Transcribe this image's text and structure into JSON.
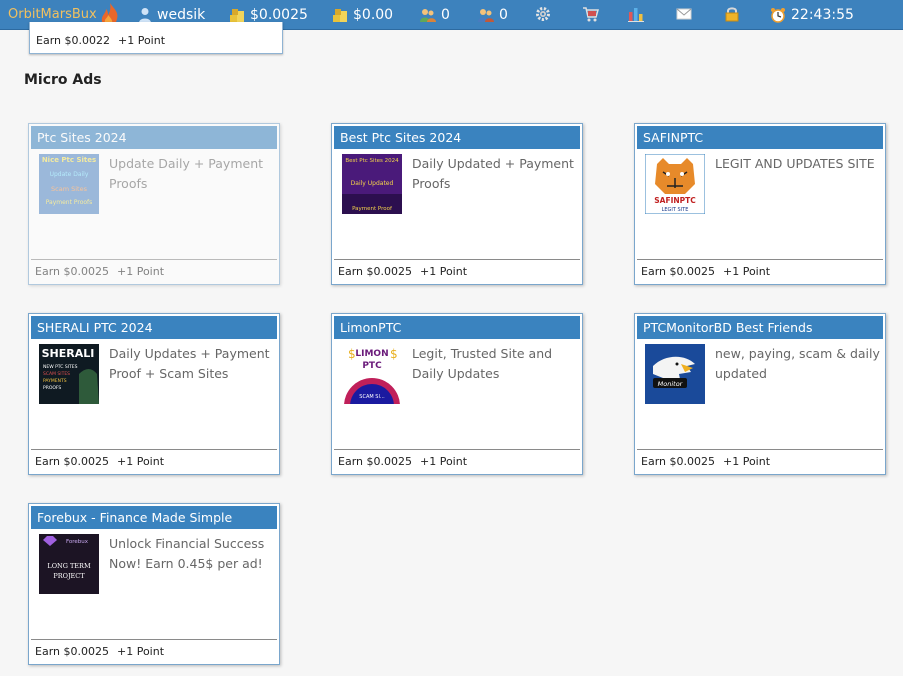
{
  "topbar": {
    "brand": "OrbitMarsBux",
    "username": "wedsik",
    "balance_main": "$0.0025",
    "balance_purchase": "$0.00",
    "referrals_direct": "0",
    "referrals_rented": "0",
    "clock": "22:43:55"
  },
  "previous_card": {
    "earn": "Earn $0.0022",
    "points": "+1 Point"
  },
  "section_title": "Micro Ads",
  "ads": [
    {
      "title": "Ptc Sites 2024",
      "desc": "Update Daily + Payment Proofs",
      "earn": "Earn $0.0025",
      "points": "+1 Point",
      "thumb": [
        "Nice Ptc Sites",
        "Update Daily",
        "Scam Sites",
        "Payment Proofs"
      ],
      "faded": true
    },
    {
      "title": "Best Ptc Sites 2024",
      "desc": "Daily Updated + Payment Proofs",
      "earn": "Earn $0.0025",
      "points": "+1 Point",
      "thumb": [
        "Best Ptc Sites 2024",
        "Daily Updated",
        "Payment Proof"
      ]
    },
    {
      "title": "SAFINPTC",
      "desc": "LEGIT AND UPDATES SITE",
      "earn": "Earn $0.0025",
      "points": "+1 Point",
      "thumb": [
        "SAFINPTC",
        "LEGIT SITE"
      ]
    },
    {
      "title": "SHERALI PTC 2024",
      "desc": "Daily Updates + Payment Proof + Scam Sites",
      "earn": "Earn $0.0025",
      "points": "+1 Point",
      "thumb": [
        "SHERALI",
        "NEW PTC SITES",
        "SCAM SITES",
        "PAYMENTS",
        "PROOFS"
      ]
    },
    {
      "title": "LimonPTC",
      "desc": "Legit, Trusted Site and Daily Updates",
      "earn": "Earn $0.0025",
      "points": "+1 Point",
      "thumb": [
        "LIMON",
        "PTC",
        "SCAM SI..."
      ]
    },
    {
      "title": "PTCMonitorBD Best Friends",
      "desc": "new, paying, scam & daily updated",
      "earn": "Earn $0.0025",
      "points": "+1 Point",
      "thumb": [
        "Monitor"
      ]
    },
    {
      "title": "Forebux - Finance Made Simple",
      "desc": "Unlock Financial Success Now! Earn 0.45$ per ad!",
      "earn": "Earn $0.0025",
      "points": "+1 Point",
      "thumb": [
        "Forebux",
        "LONG TERM",
        "PROJECT"
      ]
    }
  ],
  "colors": {
    "topbar": "#3d82bd",
    "card_header": "#3a83bf",
    "brand": "#f0c060"
  }
}
